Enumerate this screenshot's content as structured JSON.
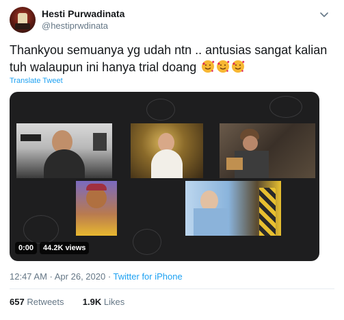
{
  "header": {
    "display_name": "Hesti Purwadinata",
    "handle": "@hestiprwdinata"
  },
  "tweet": {
    "text": "Thankyou semuanya yg udah ntn .. antusias sangat kalian tuh walaupun ini hanya trial doang",
    "emoji": [
      "smiling-face-with-hearts",
      "smiling-face-with-hearts",
      "smiling-face-with-hearts"
    ],
    "translate_label": "Translate Tweet"
  },
  "media": {
    "time": "0:00",
    "views": "44.2K views"
  },
  "meta": {
    "timestamp": "12:47 AM · Apr 26, 2020 ·",
    "source": "Twitter for iPhone"
  },
  "stats": {
    "retweets_count": "657",
    "retweets_label": "Retweets",
    "likes_count": "1.9K",
    "likes_label": "Likes"
  },
  "colors": {
    "link": "#1da1f2",
    "secondary_text": "#657786",
    "media_bg": "#1e1e1f"
  }
}
